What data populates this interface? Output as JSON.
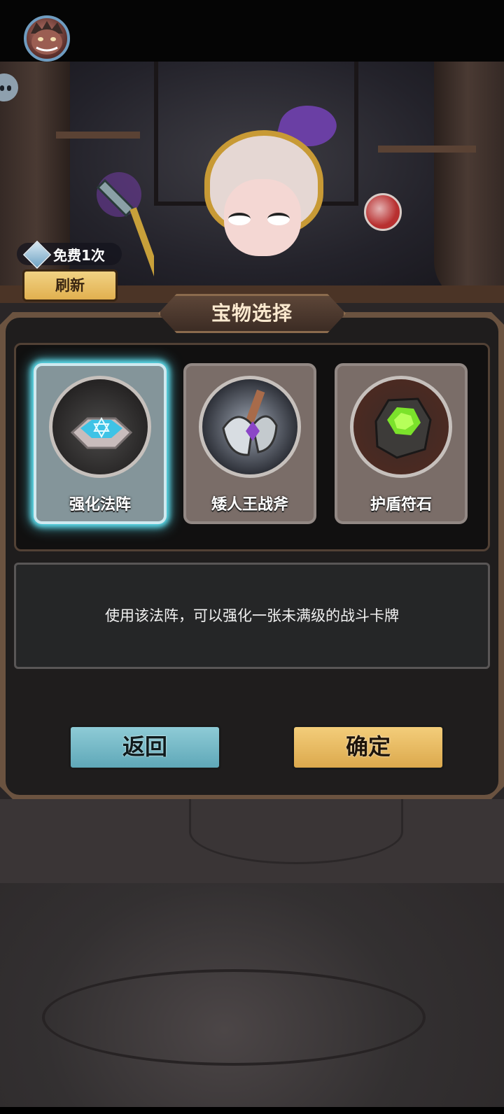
{
  "header": {
    "avatar_icon": "boar-avatar"
  },
  "shop": {
    "free_refresh": "免费1次",
    "refresh_label": "刷新"
  },
  "panel": {
    "title": "宝物选择",
    "cards": [
      {
        "label": "强化法阵",
        "icon": "magic-circle-icon",
        "selected": true
      },
      {
        "label": "矮人王战斧",
        "icon": "battle-axe-icon",
        "selected": false
      },
      {
        "label": "护盾符石",
        "icon": "rune-stone-icon",
        "selected": false
      }
    ],
    "description": "使用该法阵，可以强化一张未满级的战斗卡牌",
    "back_label": "返回",
    "confirm_label": "确定"
  },
  "colors": {
    "selected_glow": "#5de0f0",
    "confirm_button": "#e5b75c",
    "back_button": "#78bccb",
    "panel_bg": "#1f1d1d"
  }
}
